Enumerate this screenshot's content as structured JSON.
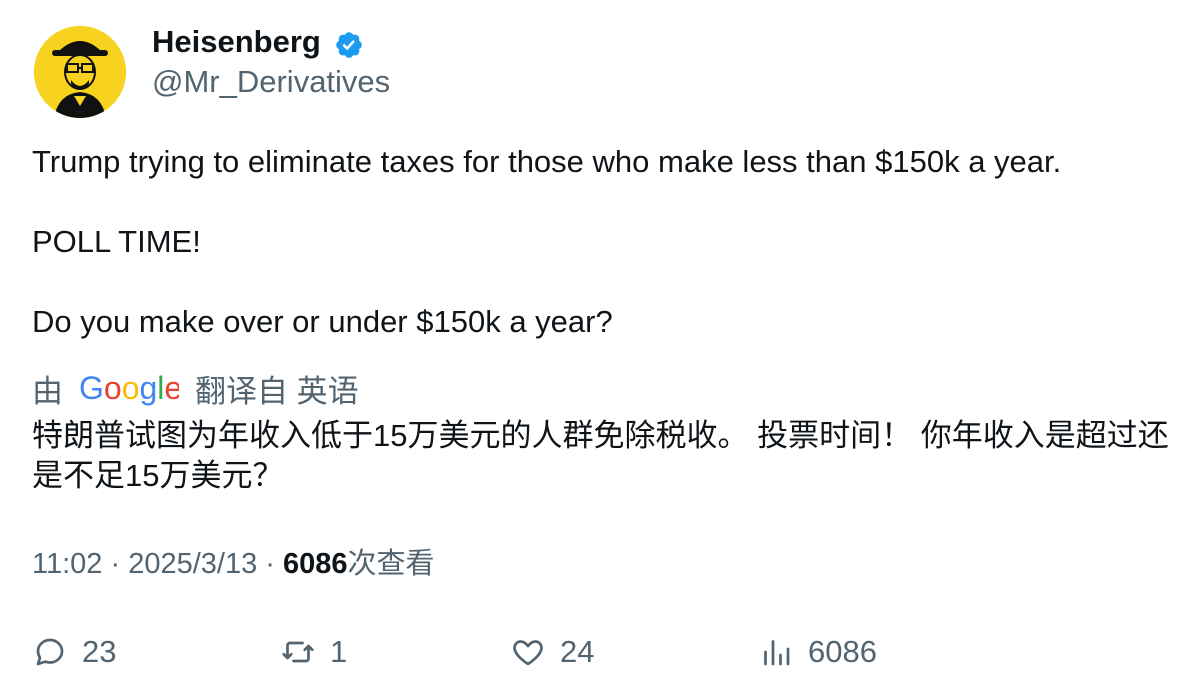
{
  "author": {
    "display_name": "Heisenberg",
    "handle": "@Mr_Derivatives",
    "verified": true,
    "avatar_icon": "heisenberg-avatar-icon",
    "avatar_bg": "#f7d21f"
  },
  "tweet": {
    "text": "Trump trying to eliminate taxes for those who make less than $150k a year.\n\nPOLL TIME!\n\nDo you make over or under $150k a year?"
  },
  "translation": {
    "prefix": "由",
    "provider": "Google",
    "suffix": "翻译自 英语",
    "text": "特朗普试图为年收入低于15万美元的人群免除税收。 投票时间！ 你年收入是超过还是不足15万美元？"
  },
  "meta": {
    "time": "11:02",
    "separator": "·",
    "date": "2025/3/13",
    "views_count": "6086",
    "views_label": "次查看"
  },
  "actions": {
    "reply_count": "23",
    "retweet_count": "1",
    "like_count": "24",
    "views_count": "6086"
  },
  "colors": {
    "verified": "#1d9bf0",
    "secondary_text": "#536471",
    "primary_text": "#0f1419"
  }
}
